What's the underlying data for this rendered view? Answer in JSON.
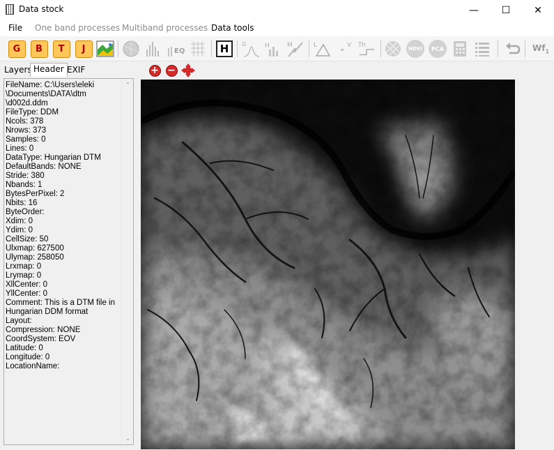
{
  "window": {
    "title": "Data stock",
    "minimize": "—",
    "maximize": "☐",
    "close": "✕"
  },
  "menu": {
    "items": [
      {
        "label": "File",
        "enabled": true
      },
      {
        "label": "One band processes",
        "enabled": false
      },
      {
        "label": "Multiband processes",
        "enabled": false
      },
      {
        "label": "Data tools",
        "enabled": true
      }
    ]
  },
  "toolbar": {
    "letter_buttons": [
      "G",
      "B",
      "T",
      "J"
    ],
    "header_button": "H",
    "labels": {
      "eq": "EQ",
      "g": "G",
      "h": "H",
      "m": "M",
      "l": "L",
      "v": "V",
      "th": "Th",
      "ndvi": "NDVI",
      "pca": "PCA",
      "wf": "Wf",
      "wf_sub": "1"
    },
    "icons": [
      "color-image-icon",
      "sphere-icon",
      "histogram-icon",
      "eq-histogram-icon",
      "grid-icon",
      "header-icon",
      "gauss-icon",
      "h-icon",
      "m-icon",
      "l-triangle-icon",
      "v-lightning-icon",
      "threshold-icon",
      "mosaic-icon",
      "ndvi-icon",
      "pca-icon",
      "calculator-icon",
      "list-icon",
      "undo-icon",
      "wf-icon"
    ]
  },
  "tabs": [
    {
      "label": "Layers",
      "active": false
    },
    {
      "label": "Header",
      "active": true
    },
    {
      "label": "EXIF",
      "active": false
    }
  ],
  "header_lines": [
    "FileName: C:\\Users\\eleki",
    "\\Documents\\DATA\\dtm",
    "\\d002d.ddm",
    "FileType: DDM",
    "Ncols: 378",
    "Nrows: 373",
    "Samples: 0",
    "Lines: 0",
    "DataType: Hungarian DTM",
    "DefaultBands: NONE",
    "Stride: 380",
    "Nbands: 1",
    "BytesPerPixel: 2",
    "Nbits: 16",
    "ByteOrder:",
    "Xdim: 0",
    "Ydim: 0",
    "CellSize: 50",
    "Ulxmap: 627500",
    "Ulymap: 258050",
    "Lrxmap: 0",
    "Lrymap: 0",
    "XllCenter: 0",
    "YllCenter: 0",
    "Comment: This is a DTM file in",
    "Hungarian DDM format",
    "Layout:",
    "Compression: NONE",
    "CoordSystem: EOV",
    "Latitude: 0",
    "Longitude: 0",
    "LocationName:"
  ],
  "view_tools": {
    "zoom_in": "+",
    "zoom_out": "−"
  },
  "colors": {
    "letter_bg": "#ffc75a",
    "letter_text": "#b30000",
    "zoom_red": "#d42a2a"
  }
}
